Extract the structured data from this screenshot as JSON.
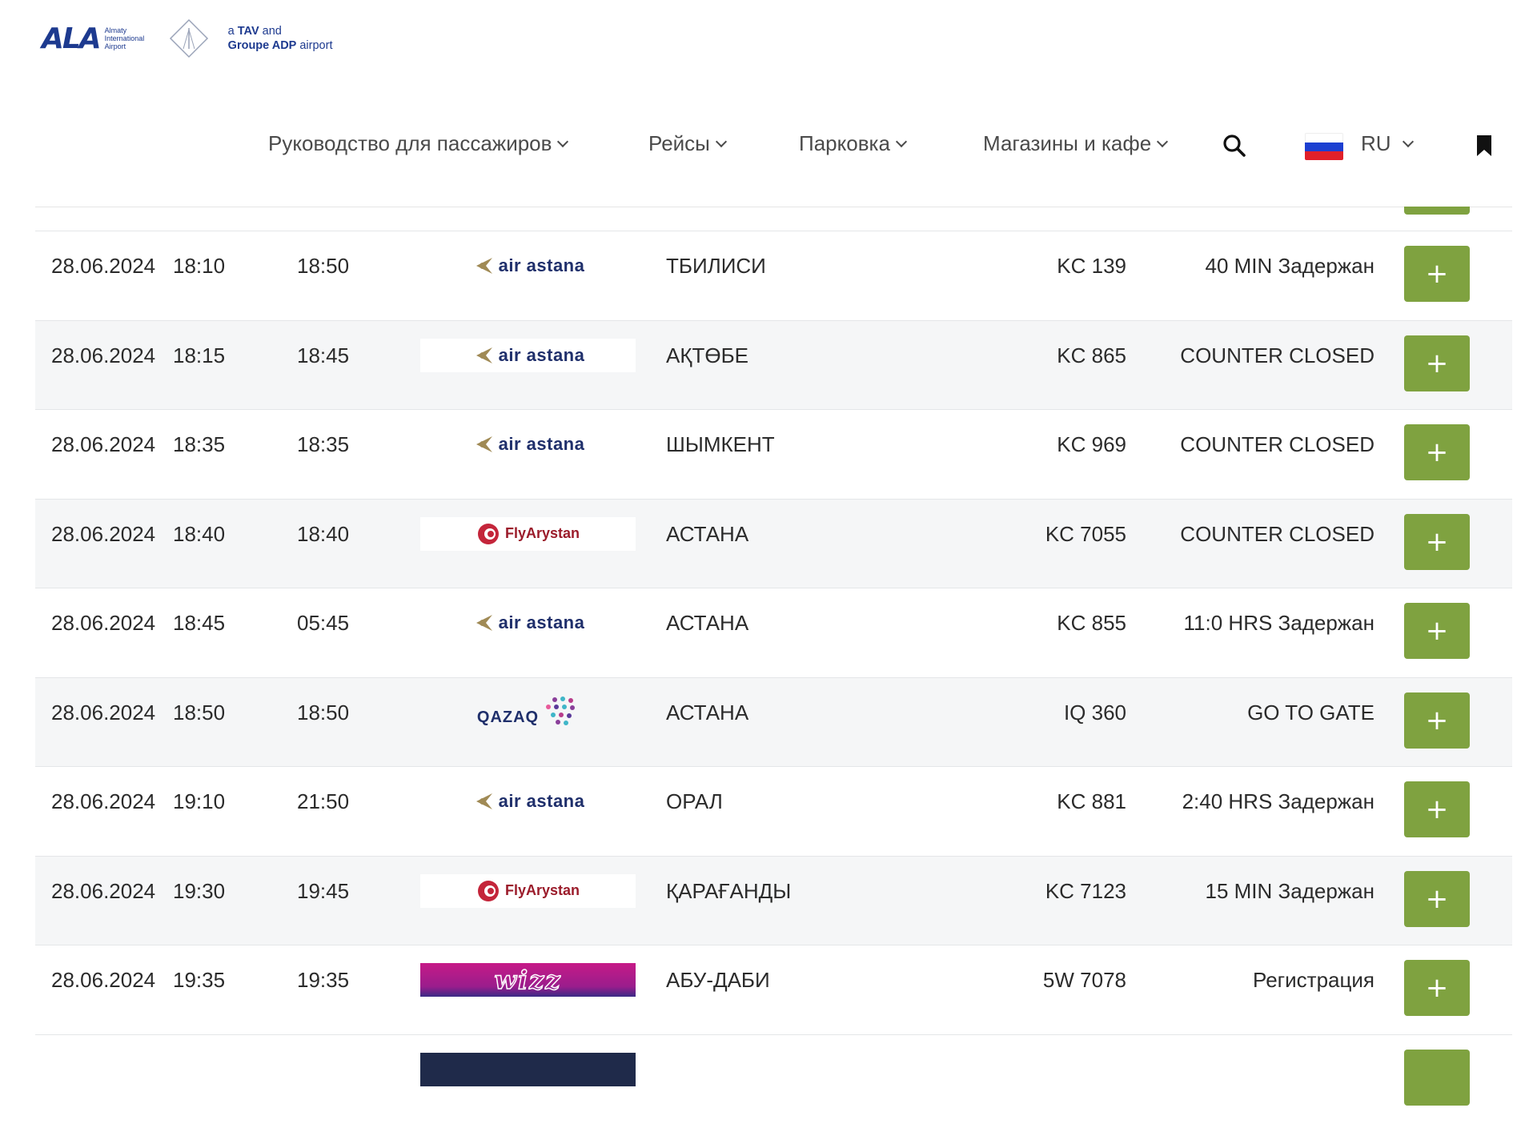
{
  "header": {
    "logo_mark": "ALA",
    "logo_sub": [
      "Almaty",
      "International",
      "Airport"
    ],
    "tav_line1_prefix": "a ",
    "tav_line1_bold": "TAV",
    "tav_line1_suffix": " and",
    "tav_line2_bold": "Groupe ADP",
    "tav_line2_suffix": " airport"
  },
  "nav": {
    "items": [
      "Руководство для пассажиров",
      "Рейсы",
      "Парковка",
      "Магазины и кафе"
    ],
    "language": "RU"
  },
  "flights": [
    {
      "date": "28.06.2024",
      "time": "18:10",
      "estimated": "18:50",
      "airline": "air astana",
      "airline_logo": "air-astana",
      "destination": "ТБИЛИСИ",
      "flight": "KC 139",
      "status": "40 MIN Задержан"
    },
    {
      "date": "28.06.2024",
      "time": "18:15",
      "estimated": "18:45",
      "airline": "air astana",
      "airline_logo": "air-astana",
      "destination": "АҚТӨБЕ",
      "flight": "KC 865",
      "status": "COUNTER CLOSED"
    },
    {
      "date": "28.06.2024",
      "time": "18:35",
      "estimated": "18:35",
      "airline": "air astana",
      "airline_logo": "air-astana",
      "destination": "ШЫМКЕНТ",
      "flight": "KC 969",
      "status": "COUNTER CLOSED"
    },
    {
      "date": "28.06.2024",
      "time": "18:40",
      "estimated": "18:40",
      "airline": "FlyArystan",
      "airline_logo": "flyarystan",
      "destination": "АСТАНА",
      "flight": "KC 7055",
      "status": "COUNTER CLOSED"
    },
    {
      "date": "28.06.2024",
      "time": "18:45",
      "estimated": "05:45",
      "airline": "air astana",
      "airline_logo": "air-astana",
      "destination": "АСТАНА",
      "flight": "KC 855",
      "status": "11:0 HRS Задержан"
    },
    {
      "date": "28.06.2024",
      "time": "18:50",
      "estimated": "18:50",
      "airline": "QAZAQ",
      "airline_logo": "qazaq",
      "destination": "АСТАНА",
      "flight": "IQ 360",
      "status": "GO TO GATE"
    },
    {
      "date": "28.06.2024",
      "time": "19:10",
      "estimated": "21:50",
      "airline": "air astana",
      "airline_logo": "air-astana",
      "destination": "ОРАЛ",
      "flight": "KC 881",
      "status": "2:40 HRS Задержан"
    },
    {
      "date": "28.06.2024",
      "time": "19:30",
      "estimated": "19:45",
      "airline": "FlyArystan",
      "airline_logo": "flyarystan",
      "destination": "ҚАРАҒАНДЫ",
      "flight": "KC 7123",
      "status": "15 MIN Задержан"
    },
    {
      "date": "28.06.2024",
      "time": "19:35",
      "estimated": "19:35",
      "airline": "wizz",
      "airline_logo": "wizz",
      "destination": "АБУ-ДАБИ",
      "flight": "5W 7078",
      "status": "Регистрация"
    }
  ],
  "plus_label": "+",
  "colors": {
    "button": "#7fa240",
    "brand": "#1d3a8f",
    "alt_row": "#f5f6f7"
  }
}
